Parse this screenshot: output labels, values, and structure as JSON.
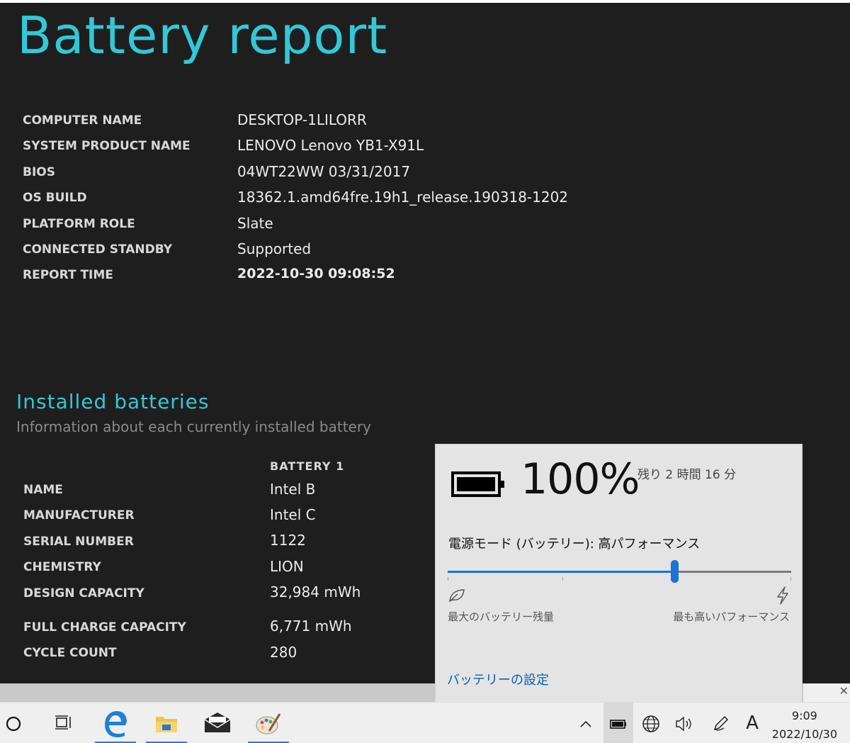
{
  "report": {
    "title": "Battery report",
    "info": [
      {
        "key": "COMPUTER NAME",
        "value": "DESKTOP-1LILORR"
      },
      {
        "key": "SYSTEM PRODUCT NAME",
        "value": "LENOVO Lenovo YB1-X91L"
      },
      {
        "key": "BIOS",
        "value": "04WT22WW 03/31/2017"
      },
      {
        "key": "OS BUILD",
        "value": "18362.1.amd64fre.19h1_release.190318-1202"
      },
      {
        "key": "PLATFORM ROLE",
        "value": "Slate"
      },
      {
        "key": "CONNECTED STANDBY",
        "value": "Supported"
      },
      {
        "key": "REPORT TIME",
        "value": "2022-10-30  09:08:52"
      }
    ],
    "installed": {
      "title": "Installed batteries",
      "subtitle": "Information about each currently installed battery",
      "column_header": "BATTERY 1",
      "rows": [
        {
          "key": "NAME",
          "value": "Intel B"
        },
        {
          "key": "MANUFACTURER",
          "value": "Intel C"
        },
        {
          "key": "SERIAL NUMBER",
          "value": "1122"
        },
        {
          "key": "CHEMISTRY",
          "value": "LION"
        },
        {
          "key": "DESIGN CAPACITY",
          "value": "32,984 mWh"
        },
        {
          "key": "FULL CHARGE CAPACITY",
          "value": "6,771 mWh"
        },
        {
          "key": "CYCLE COUNT",
          "value": "280"
        }
      ]
    },
    "scrollbar_close": "✕"
  },
  "flyout": {
    "percent": "100%",
    "charge_level": 1.0,
    "remaining": "残り 2 時間 16 分",
    "mode_label": "電源モード (バッテリー): 高パフォーマンス",
    "slider_value_fraction": 0.66,
    "min_label": "最大のバッテリー残量",
    "max_label": "最も高いパフォーマンス",
    "settings_link": "バッテリーの設定",
    "accent_color": "#1a73d6",
    "left_icon": "leaf-icon",
    "right_icon": "lightning-bolt-icon"
  },
  "taskbar": {
    "apps": [
      {
        "name": "cortana-search-icon",
        "active": false
      },
      {
        "name": "task-view-icon",
        "active": false
      },
      {
        "name": "edge-browser-icon",
        "active": true
      },
      {
        "name": "file-explorer-icon",
        "active": true
      },
      {
        "name": "mail-icon",
        "active": false
      },
      {
        "name": "paint-icon",
        "active": true
      }
    ],
    "tray": [
      {
        "name": "chevron-up-icon",
        "active": false
      },
      {
        "name": "battery-icon",
        "active": true
      },
      {
        "name": "globe-network-icon",
        "active": false
      },
      {
        "name": "speaker-volume-icon",
        "active": false
      },
      {
        "name": "pen-icon",
        "active": false
      }
    ],
    "ime": "A",
    "time": "9:09",
    "date": "2022/10/30"
  }
}
